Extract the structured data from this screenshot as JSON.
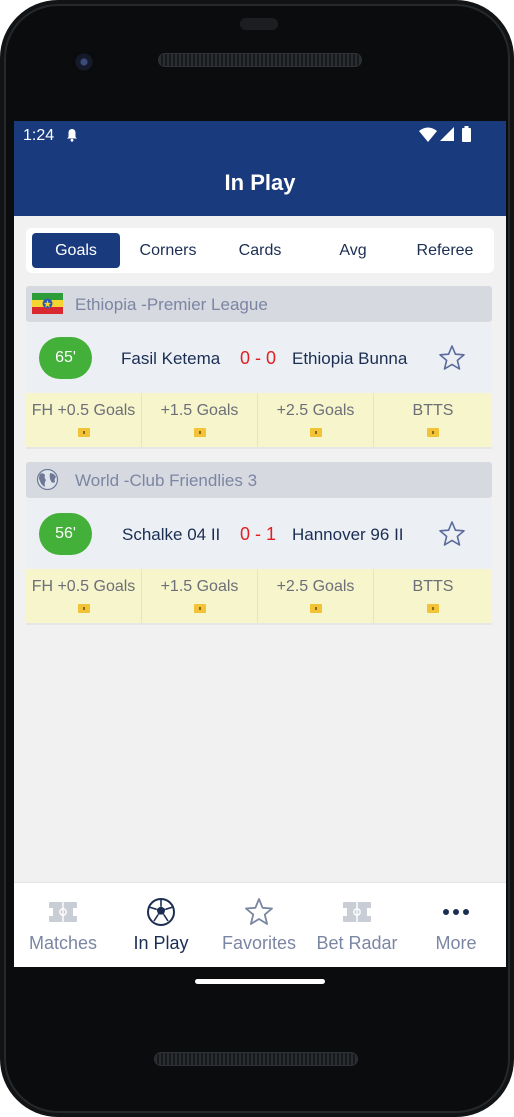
{
  "status_bar": {
    "time": "1:24"
  },
  "app_bar": {
    "title": "In Play"
  },
  "tabs": [
    {
      "label": "Goals",
      "active": true
    },
    {
      "label": "Corners",
      "active": false
    },
    {
      "label": "Cards",
      "active": false
    },
    {
      "label": "Avg",
      "active": false
    },
    {
      "label": "Referee",
      "active": false
    }
  ],
  "leagues": [
    {
      "name": "Ethiopia -Premier League",
      "icon": "ethiopia-flag",
      "match": {
        "minute": "65'",
        "home": "Fasil Ketema",
        "score": "0 - 0",
        "away": "Ethiopia Bunna",
        "odds": [
          "FH +0.5 Goals",
          "+1.5 Goals",
          "+2.5 Goals",
          "BTTS"
        ]
      }
    },
    {
      "name": "World -Club Friendlies 3",
      "icon": "globe",
      "match": {
        "minute": "56'",
        "home": "Schalke 04 II",
        "score": "0 - 1",
        "away": "Hannover 96 II",
        "odds": [
          "FH +0.5 Goals",
          "+1.5 Goals",
          "+2.5 Goals",
          "BTTS"
        ]
      }
    }
  ],
  "bottom_nav": [
    {
      "label": "Matches",
      "icon": "pitch-icon",
      "active": false
    },
    {
      "label": "In Play",
      "icon": "soccer-ball-icon",
      "active": true
    },
    {
      "label": "Favorites",
      "icon": "star-icon",
      "active": false
    },
    {
      "label": "Bet Radar",
      "icon": "pitch-icon",
      "active": false
    },
    {
      "label": "More",
      "icon": "more-dots-icon",
      "active": false
    }
  ],
  "colors": {
    "primary": "#1a3a7e",
    "live_green": "#43b039",
    "score_red": "#e02020",
    "odds_bg": "#f6f5cb"
  }
}
